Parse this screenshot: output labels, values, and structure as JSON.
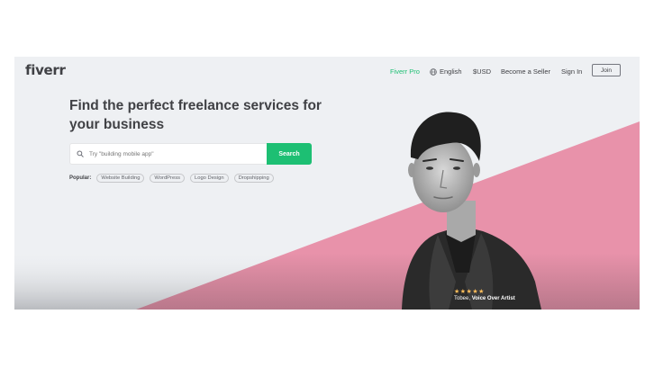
{
  "header": {
    "logo": "fiverr",
    "nav": {
      "fiverr_pro": "Fiverr Pro",
      "language": "English",
      "currency": "$USD",
      "become_seller": "Become a Seller",
      "sign_in": "Sign In",
      "join": "Join"
    }
  },
  "hero": {
    "headline": "Find the perfect freelance services for your business",
    "search": {
      "placeholder": "Try \"building mobile app\"",
      "button": "Search"
    },
    "popular": {
      "label": "Popular:",
      "tags": [
        "Website Building",
        "WordPress",
        "Logo Design",
        "Dropshipping"
      ]
    },
    "caption": {
      "stars": "★★★★★",
      "name": "Tobee,",
      "role": "Voice Over Artist"
    }
  },
  "colors": {
    "brand_green": "#1dbf73",
    "pink": "#e68ea6",
    "text_dark": "#404145",
    "star_yellow": "#ffbe5b"
  },
  "icons": [
    "globe-icon",
    "search-icon"
  ]
}
